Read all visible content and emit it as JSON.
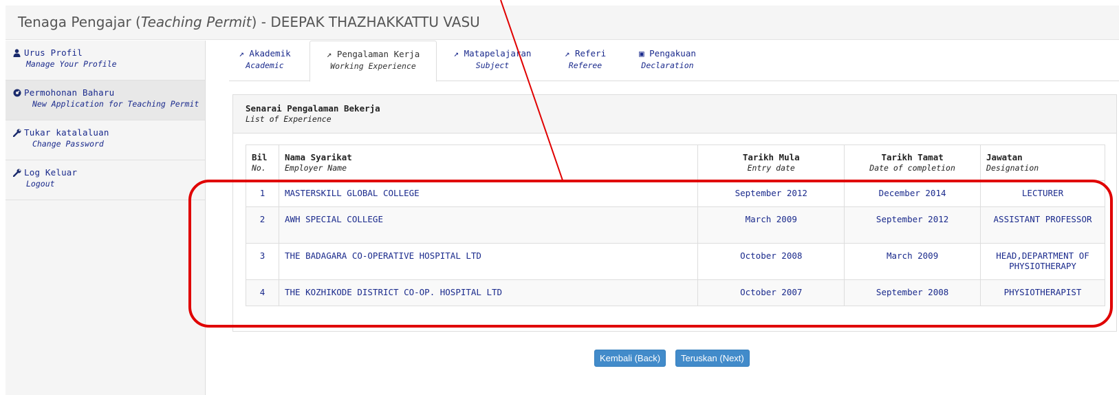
{
  "header": {
    "title_prefix": "Tenaga Pengajar (",
    "title_italic": "Teaching Permit",
    "title_suffix": ") - DEEPAK THAZHAKKATTU VASU"
  },
  "sidebar": {
    "items": [
      {
        "label": "Urus Profil",
        "sub": "Manage Your Profile",
        "icon": "user-icon"
      },
      {
        "label": "Permohonan Baharu",
        "sub": "New Application for Teaching Permit",
        "icon": "dashboard-icon"
      },
      {
        "label": "Tukar katalaluan",
        "sub": "Change Password",
        "icon": "wrench-icon"
      },
      {
        "label": "Log Keluar",
        "sub": "Logout",
        "icon": "wrench-icon"
      }
    ]
  },
  "tabs": [
    {
      "label": "Akademik",
      "sub": "Academic",
      "icon": "external-link-icon"
    },
    {
      "label": "Pengalaman Kerja",
      "sub": "Working Experience",
      "icon": "external-link-icon"
    },
    {
      "label": "Matapelajaran",
      "sub": "Subject",
      "icon": "external-link-icon"
    },
    {
      "label": "Referi",
      "sub": "Referee",
      "icon": "external-link-icon"
    },
    {
      "label": "Pengakuan",
      "sub": "Declaration",
      "icon": "print-icon"
    }
  ],
  "panel": {
    "title": "Senarai Pengalaman Bekerja",
    "subtitle": "List of Experience"
  },
  "table": {
    "headers": {
      "no": "Bil",
      "no_sub": "No.",
      "name": "Nama Syarikat",
      "name_sub": "Employer Name",
      "start": "Tarikh Mula",
      "start_sub": "Entry date",
      "end": "Tarikh Tamat",
      "end_sub": "Date of completion",
      "role": "Jawatan",
      "role_sub": "Designation"
    },
    "rows": [
      {
        "no": "1",
        "name": "MASTERSKILL GLOBAL COLLEGE",
        "start": "September 2012",
        "end": "December 2014",
        "role": "LECTURER"
      },
      {
        "no": "2",
        "name": "AWH SPECIAL COLLEGE",
        "start": "March 2009",
        "end": "September 2012",
        "role": "ASSISTANT PROFESSOR"
      },
      {
        "no": "3",
        "name": "THE BADAGARA CO-OPERATIVE HOSPITAL LTD",
        "start": "October 2008",
        "end": "March 2009",
        "role": "HEAD,DEPARTMENT OF PHYSIOTHERAPY"
      },
      {
        "no": "4",
        "name": "THE KOZHIKODE DISTRICT CO-OP. HOSPITAL LTD",
        "start": "October 2007",
        "end": "September 2008",
        "role": "PHYSIOTHERAPIST"
      }
    ]
  },
  "buttons": {
    "back": "Kembali (Back)",
    "next": "Teruskan (Next)"
  },
  "colors": {
    "link": "#1a2a8c",
    "button": "#428bca",
    "annotation": "#e00000"
  }
}
